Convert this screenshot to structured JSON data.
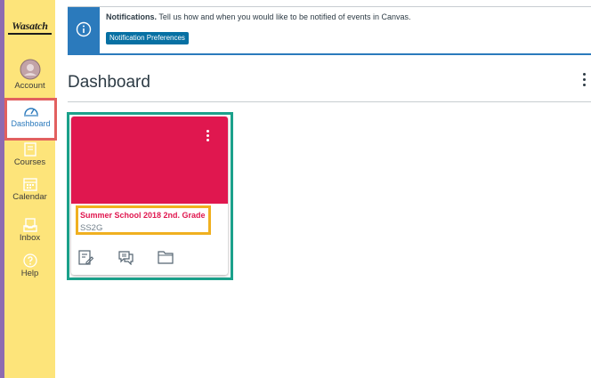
{
  "nav": {
    "logo": "Wasatch",
    "items": [
      {
        "label": "Account",
        "icon": "account-avatar-icon"
      },
      {
        "label": "Dashboard",
        "icon": "dashboard-gauge-icon"
      },
      {
        "label": "Courses",
        "icon": "book-icon"
      },
      {
        "label": "Calendar",
        "icon": "calendar-icon"
      },
      {
        "label": "Inbox",
        "icon": "inbox-icon"
      },
      {
        "label": "Help",
        "icon": "help-icon"
      }
    ]
  },
  "notification": {
    "title": "Notifications.",
    "message": "Tell us how and when you would like to be notified of events in Canvas.",
    "button_label": "Notification Preferences",
    "icon": "info-icon"
  },
  "header": {
    "title": "Dashboard",
    "options_icon": "kebab-menu-icon"
  },
  "course_cards": [
    {
      "title": "Summer School 2018 2nd. Grade",
      "code": "SS2G",
      "color": "#e0174f",
      "actions": [
        "assignments-icon",
        "discussions-icon",
        "files-icon"
      ]
    }
  ],
  "colors": {
    "nav_bg": "#fde47a",
    "brand_blue": "#2b7abc",
    "card_color": "#e0174f",
    "highlight_red": "#e2605f",
    "highlight_teal": "#1ba18b",
    "highlight_yellow": "#f0b020"
  }
}
